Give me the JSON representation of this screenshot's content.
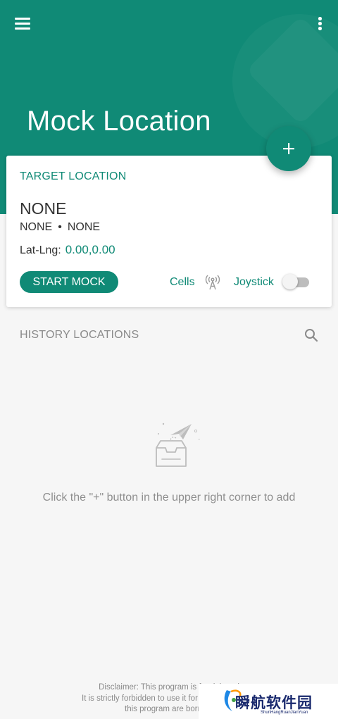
{
  "app": {
    "title": "Mock Location"
  },
  "toolbar": {
    "menu_icon": "menu-icon",
    "more_icon": "more-vertical-icon",
    "fab_icon": "plus-icon"
  },
  "target": {
    "heading": "TARGET LOCATION",
    "name": "NONE",
    "sub_left": "NONE",
    "separator": "•",
    "sub_right": "NONE",
    "latlng_label": "Lat-Lng:",
    "latlng_value": "0.00,0.00",
    "start_button": "START MOCK",
    "cells_label": "Cells",
    "cells_icon": "antenna-icon",
    "joystick_label": "Joystick",
    "joystick_enabled": false
  },
  "history": {
    "heading": "HISTORY LOCATIONS",
    "search_icon": "search-icon",
    "empty_icon": "empty-inbox-icon",
    "empty_text": "Click the \"+\" button in the upper right corner to add"
  },
  "footer": {
    "disclaimer_line1": "Disclaimer: This program is for debuggi",
    "disclaimer_line2": "It is strictly forbidden to use it for illegal activities.",
    "disclaimer_line3": "this program are borne b"
  },
  "watermark": {
    "text": "瞬航软件园",
    "sub": "ShunHangRuanJianYuan"
  },
  "colors": {
    "primary": "#108a76",
    "background": "#f6f6f6",
    "card": "#ffffff"
  }
}
